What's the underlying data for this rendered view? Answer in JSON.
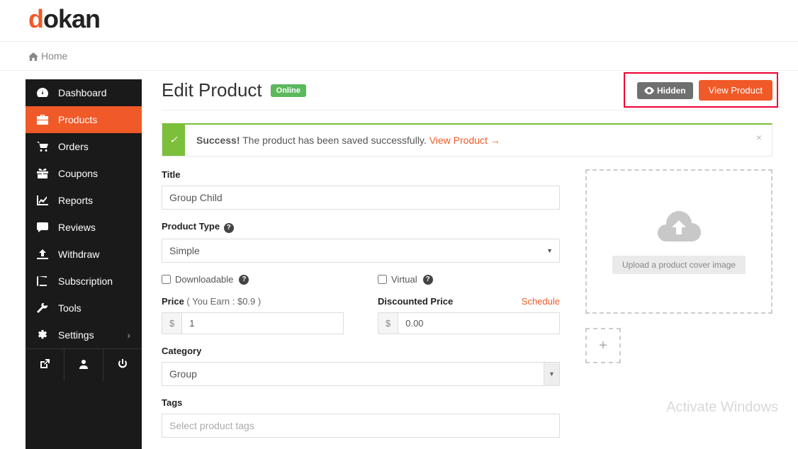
{
  "logo": {
    "d": "d",
    "rest": "okan"
  },
  "breadcrumb": {
    "home": "Home"
  },
  "sidebar": {
    "items": [
      {
        "label": "Dashboard"
      },
      {
        "label": "Products"
      },
      {
        "label": "Orders"
      },
      {
        "label": "Coupons"
      },
      {
        "label": "Reports"
      },
      {
        "label": "Reviews"
      },
      {
        "label": "Withdraw"
      },
      {
        "label": "Subscription"
      },
      {
        "label": "Tools"
      },
      {
        "label": "Settings"
      }
    ]
  },
  "header": {
    "title": "Edit Product",
    "online": "Online",
    "hidden": "Hidden",
    "view": "View Product"
  },
  "alert": {
    "strong": "Success!",
    "text": " The product has been saved successfully. ",
    "link": "View Product →",
    "close": "×"
  },
  "form": {
    "title_label": "Title",
    "title_value": "Group Child",
    "type_label": "Product Type ",
    "type_value": "Simple",
    "downloadable": "Downloadable ",
    "virtual": "Virtual ",
    "price_label": "Price",
    "price_sub": " ( You Earn : $0.9 )",
    "price_cur": "$",
    "price_value": "1",
    "disc_label": "Discounted Price",
    "disc_value": "0.00",
    "schedule": "Schedule",
    "category_label": "Category",
    "category_value": "Group",
    "tags_label": "Tags",
    "tags_placeholder": "Select product tags"
  },
  "upload": {
    "text": "Upload a product cover image",
    "plus": "+"
  },
  "watermark": "Activate Windows"
}
